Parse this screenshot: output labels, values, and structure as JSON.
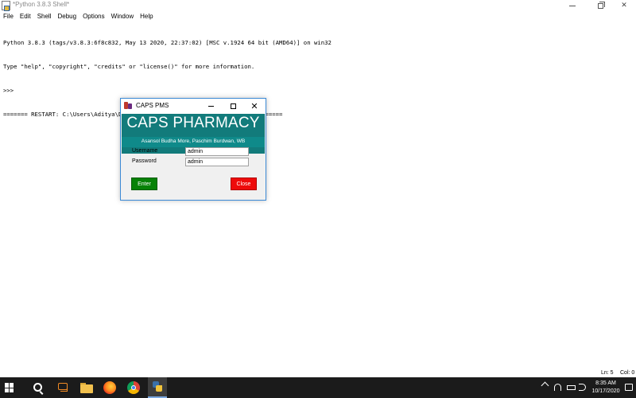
{
  "shell": {
    "title": "*Python 3.8.3 Shell*",
    "menu": [
      "File",
      "Edit",
      "Shell",
      "Debug",
      "Options",
      "Window",
      "Help"
    ],
    "console_lines": [
      "Python 3.8.3 (tags/v3.8.3:6f8c832, May 13 2020, 22:37:02) [MSC v.1924 64 bit (AMD64)] on win32",
      "Type \"help\", \"copyright\", \"credits\" or \"license()\" for more information.",
      ">>>",
      "======= RESTART: C:\\Users\\Aditya\\Desktop\\Pharmacy-Management\\CAPS_PMS.py ======="
    ],
    "status": {
      "ln": "Ln: 5",
      "col": "Col: 0"
    }
  },
  "dialog": {
    "title": "CAPS PMS",
    "banner_name": "CAPS PHARMACY",
    "banner_address": "Asansol Budha More, Paschim Burdwan, WB",
    "username_label": "Username",
    "username_value": "admin",
    "password_label": "Password",
    "password_value": "admin",
    "enter_label": "Enter",
    "close_label": "Close",
    "colors": {
      "banner": "#127b7b",
      "enter": "#078207",
      "close": "#ee0b0b"
    }
  },
  "taskbar": {
    "icons": [
      "windows-start-icon",
      "search-icon",
      "task-view-icon",
      "file-explorer-icon",
      "firefox-icon",
      "chrome-icon",
      "python-idle-icon"
    ],
    "time": "8:35 AM",
    "date": "10/17/2020"
  }
}
